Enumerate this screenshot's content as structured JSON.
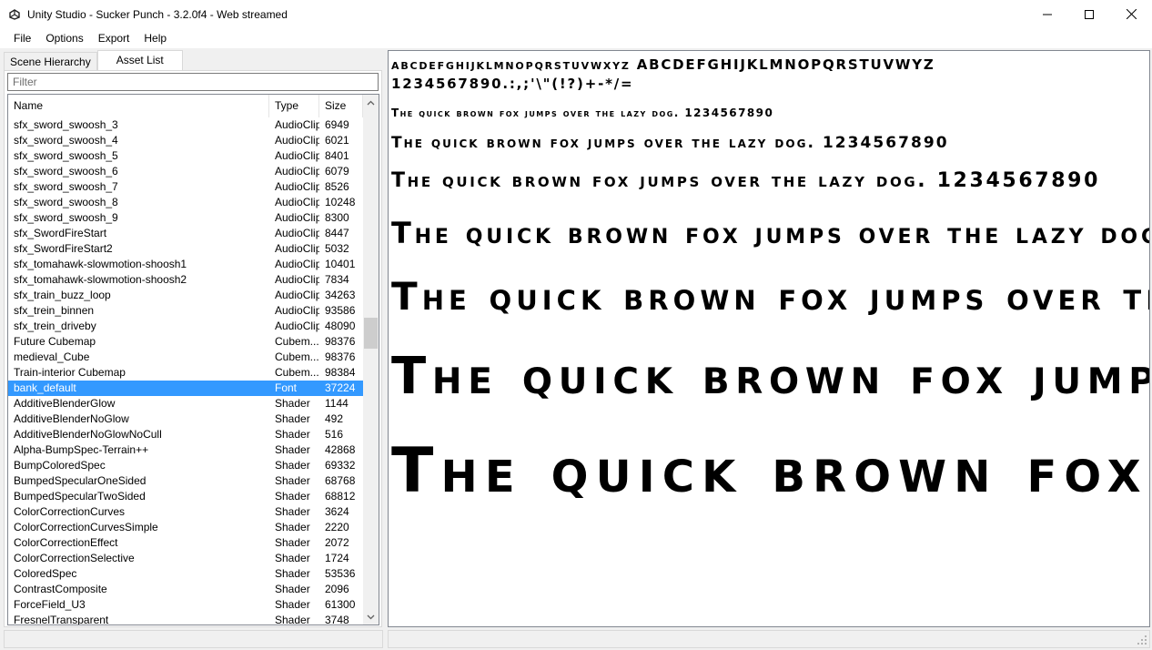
{
  "window": {
    "title": "Unity Studio - Sucker Punch - 3.2.0f4 - Web streamed"
  },
  "menu": [
    "File",
    "Options",
    "Export",
    "Help"
  ],
  "tabs": {
    "scene_hierarchy": "Scene Hierarchy",
    "asset_list": "Asset List"
  },
  "filter": {
    "placeholder": "Filter"
  },
  "columns": {
    "name": "Name",
    "type": "Type",
    "size": "Size"
  },
  "rows": [
    [
      "sfx_sword_swoosh_3",
      "AudioClip",
      "6949"
    ],
    [
      "sfx_sword_swoosh_4",
      "AudioClip",
      "6021"
    ],
    [
      "sfx_sword_swoosh_5",
      "AudioClip",
      "8401"
    ],
    [
      "sfx_sword_swoosh_6",
      "AudioClip",
      "6079"
    ],
    [
      "sfx_sword_swoosh_7",
      "AudioClip",
      "8526"
    ],
    [
      "sfx_sword_swoosh_8",
      "AudioClip",
      "10248"
    ],
    [
      "sfx_sword_swoosh_9",
      "AudioClip",
      "8300"
    ],
    [
      "sfx_SwordFireStart",
      "AudioClip",
      "8447"
    ],
    [
      "sfx_SwordFireStart2",
      "AudioClip",
      "5032"
    ],
    [
      "sfx_tomahawk-slowmotion-shoosh1",
      "AudioClip",
      "10401"
    ],
    [
      "sfx_tomahawk-slowmotion-shoosh2",
      "AudioClip",
      "7834"
    ],
    [
      "sfx_train_buzz_loop",
      "AudioClip",
      "34263"
    ],
    [
      "sfx_trein_binnen",
      "AudioClip",
      "93586"
    ],
    [
      "sfx_trein_driveby",
      "AudioClip",
      "48090"
    ],
    [
      "Future Cubemap",
      "Cubem...",
      "98376"
    ],
    [
      "medieval_Cube",
      "Cubem...",
      "98376"
    ],
    [
      "Train-interior Cubemap",
      "Cubem...",
      "98384"
    ],
    [
      "bank_default",
      "Font",
      "37224"
    ],
    [
      "AdditiveBlenderGlow",
      "Shader",
      "1144"
    ],
    [
      "AdditiveBlenderNoGlow",
      "Shader",
      "492"
    ],
    [
      "AdditiveBlenderNoGlowNoCull",
      "Shader",
      "516"
    ],
    [
      "Alpha-BumpSpec-Terrain++",
      "Shader",
      "42868"
    ],
    [
      "BumpColoredSpec",
      "Shader",
      "69332"
    ],
    [
      "BumpedSpecularOneSided",
      "Shader",
      "68768"
    ],
    [
      "BumpedSpecularTwoSided",
      "Shader",
      "68812"
    ],
    [
      "ColorCorrectionCurves",
      "Shader",
      "3624"
    ],
    [
      "ColorCorrectionCurvesSimple",
      "Shader",
      "2220"
    ],
    [
      "ColorCorrectionEffect",
      "Shader",
      "2072"
    ],
    [
      "ColorCorrectionSelective",
      "Shader",
      "1724"
    ],
    [
      "ColoredSpec",
      "Shader",
      "53536"
    ],
    [
      "ContrastComposite",
      "Shader",
      "2096"
    ],
    [
      "ForceField_U3",
      "Shader",
      "61300"
    ],
    [
      "FresnelTransparent",
      "Shader",
      "3748"
    ]
  ],
  "selected_row_name": "bank_default",
  "preview": {
    "charset_line1": "abcdefghijklmnopqrstuvwxyz ABCDEFGHIJKLMNOPQRSTUVWYZ",
    "charset_line2": "1234567890.:,;'\\\"(!?)+-*/=",
    "sample": "The quick brown fox jumps over the lazy dog. 1234567890"
  },
  "colors": {
    "selection": "#3399ff"
  }
}
